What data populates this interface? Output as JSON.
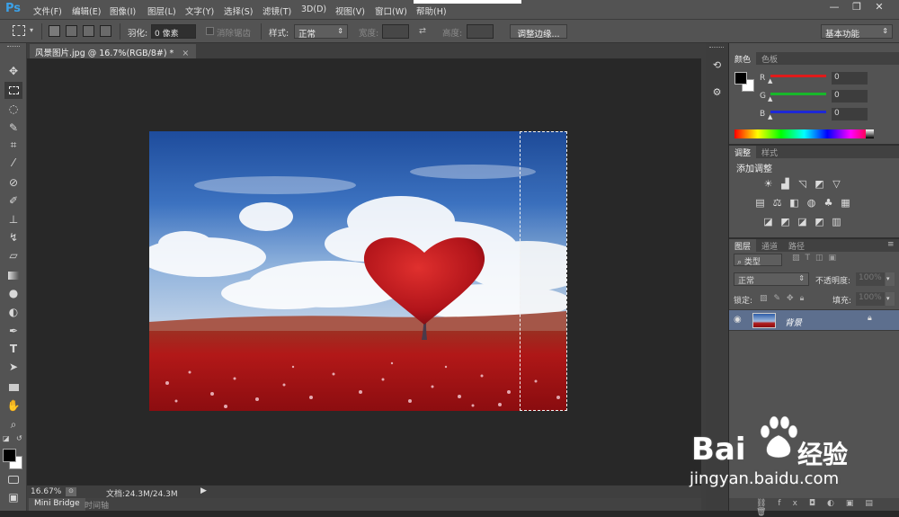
{
  "app": {
    "logo": "Ps"
  },
  "menu": [
    "文件(F)",
    "编辑(E)",
    "图像(I)",
    "图层(L)",
    "文字(Y)",
    "选择(S)",
    "滤镜(T)",
    "3D(D)",
    "视图(V)",
    "窗口(W)",
    "帮助(H)"
  ],
  "window_controls": {
    "minimize": "—",
    "restore": "❐",
    "close": "✕"
  },
  "options_bar": {
    "feather_label": "羽化:",
    "feather_value": "0 像素",
    "antialias_label": "消除锯齿",
    "style_label": "样式:",
    "style_value": "正常",
    "width_label": "宽度:",
    "height_label": "高度:",
    "refine_edge_button": "调整边缘...",
    "workspace_value": "基本功能"
  },
  "document": {
    "tab_title": "风景图片.jpg @ 16.7%(RGB/8#) *",
    "tab_close": "×"
  },
  "status": {
    "zoom": "16.67%",
    "doc_info": "文档:24.3M/24.3M"
  },
  "bottom_tabs": [
    "Mini Bridge",
    "时间轴"
  ],
  "color_panel": {
    "tabs": [
      "颜色",
      "色板"
    ],
    "channels": [
      {
        "label": "R",
        "value": "0",
        "color": "#e01b1b"
      },
      {
        "label": "G",
        "value": "0",
        "color": "#18b72a"
      },
      {
        "label": "B",
        "value": "0",
        "color": "#1d28d6"
      }
    ]
  },
  "adjust_panel": {
    "tabs": [
      "调整",
      "样式"
    ],
    "title": "添加调整"
  },
  "layers_panel": {
    "tabs": [
      "图层",
      "通道",
      "路径"
    ],
    "filter_value": "类型",
    "blend_mode": "正常",
    "opacity_label": "不透明度:",
    "opacity_value": "100%",
    "lock_label": "锁定:",
    "fill_label": "填充:",
    "fill_value": "100%",
    "layers": [
      {
        "name": "背景",
        "visible": true,
        "locked": true
      }
    ]
  },
  "watermark": {
    "brand": "Bai",
    "brand2": "经验",
    "url": "jingyan.baidu.com"
  },
  "colors": {
    "ui_bg": "#535353",
    "canvas_bg": "#282828",
    "accent": "#3ba1e8",
    "selected_layer": "#5d6f8e"
  }
}
